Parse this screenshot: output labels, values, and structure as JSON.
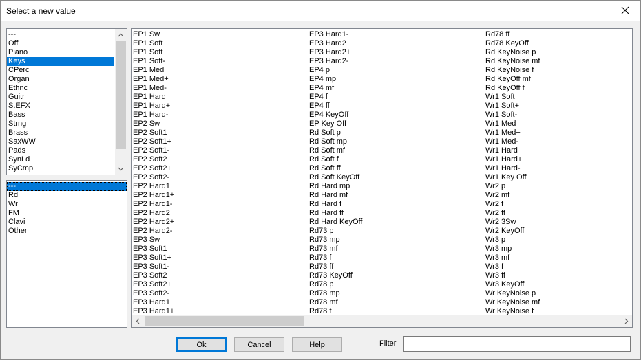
{
  "window": {
    "title": "Select a new value"
  },
  "categories": [
    "---",
    "Off",
    "Piano",
    "Keys",
    "CPerc",
    "Organ",
    "Ethnc",
    "Guitr",
    "S.EFX",
    "Bass",
    "Strng",
    "Brass",
    "SaxWW",
    "Pads",
    "SynLd",
    "SyCmp"
  ],
  "categories_selected": "Keys",
  "subcategories": [
    "---",
    "Rd",
    "Wr",
    "FM",
    "Clavi",
    "Other"
  ],
  "subcategories_selected": "---",
  "values_columns": [
    [
      "EP1 Sw",
      "EP1 Soft",
      "EP1 Soft+",
      "EP1 Soft-",
      "EP1 Med",
      "EP1 Med+",
      "EP1 Med-",
      "EP1 Hard",
      "EP1 Hard+",
      "EP1 Hard-",
      "EP2 Sw",
      "EP2 Soft1",
      "EP2 Soft1+",
      "EP2 Soft1-",
      "EP2 Soft2",
      "EP2 Soft2+",
      "EP2 Soft2-",
      "EP2 Hard1",
      "EP2 Hard1+",
      "EP2 Hard1-",
      "EP2 Hard2",
      "EP2 Hard2+",
      "EP2 Hard2-",
      "EP3 Sw",
      "EP3 Soft1",
      "EP3 Soft1+",
      "EP3 Soft1-",
      "EP3 Soft2",
      "EP3 Soft2+",
      "EP3 Soft2-",
      "EP3 Hard1",
      "EP3 Hard1+"
    ],
    [
      "EP3 Hard1-",
      "EP3 Hard2",
      "EP3 Hard2+",
      "EP3 Hard2-",
      "EP4 p",
      "EP4 mp",
      "EP4 mf",
      "EP4 f",
      "EP4 ff",
      "EP4 KeyOff",
      "EP Key Off",
      "Rd Soft p",
      "Rd Soft mp",
      "Rd Soft mf",
      "Rd Soft f",
      "Rd Soft ff",
      "Rd Soft KeyOff",
      "Rd Hard mp",
      "Rd Hard mf",
      "Rd Hard f",
      "Rd Hard ff",
      "Rd Hard KeyOff",
      "Rd73 p",
      "Rd73 mp",
      "Rd73 mf",
      "Rd73 f",
      "Rd73 ff",
      "Rd73 KeyOff",
      "Rd78 p",
      "Rd78 mp",
      "Rd78 mf",
      "Rd78 f"
    ],
    [
      "Rd78 ff",
      "Rd78 KeyOff",
      "Rd KeyNoise p",
      "Rd KeyNoise mf",
      "Rd KeyNoise f",
      "Rd KeyOff mf",
      "Rd KeyOff f",
      "Wr1 Soft",
      "Wr1 Soft+",
      "Wr1 Soft-",
      "Wr1 Med",
      "Wr1 Med+",
      "Wr1 Med-",
      "Wr1 Hard",
      "Wr1 Hard+",
      "Wr1 Hard-",
      "Wr1 Key Off",
      "Wr2 p",
      "Wr2 mf",
      "Wr2 f",
      "Wr2 ff",
      "Wr2 3Sw",
      "Wr2 KeyOff",
      "Wr3 p",
      "Wr3 mp",
      "Wr3 mf",
      "Wr3 f",
      "Wr3 ff",
      "Wr3 KeyOff",
      "Wr KeyNoise p",
      "Wr KeyNoise mf",
      "Wr KeyNoise f"
    ]
  ],
  "buttons": {
    "ok": "Ok",
    "cancel": "Cancel",
    "help": "Help"
  },
  "filter": {
    "label": "Filter",
    "value": ""
  },
  "colors": {
    "selection": "#0078d7",
    "background": "#f0f0f0"
  }
}
